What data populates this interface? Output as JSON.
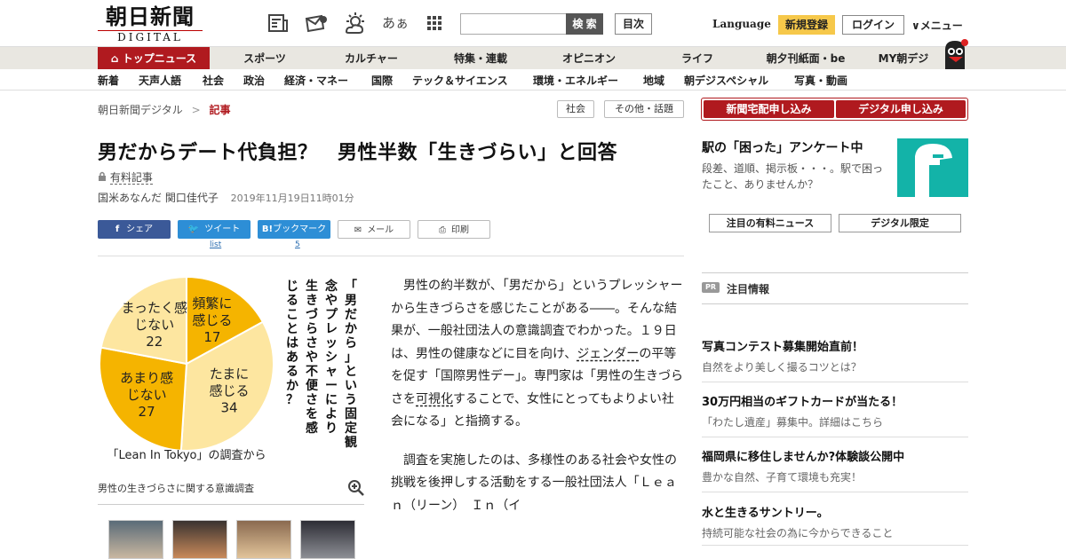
{
  "header": {
    "logo_main": "朝日新聞",
    "logo_sub": "DIGITAL",
    "icons": [
      "newspaper-icon",
      "mail-icon",
      "weather-icon",
      "font-size-icon",
      "grid-menu-icon"
    ],
    "font_icon_text": "あぁ",
    "search_placeholder": "",
    "search_button": "検 索",
    "toc_button": "目次",
    "language": "Language",
    "register": "新規登録",
    "login": "ログイン",
    "menu": "メニュー"
  },
  "nav_primary": [
    "トップニュース",
    "スポーツ",
    "カルチャー",
    "特集・連載",
    "オピニオン",
    "ライフ",
    "朝夕刊紙面・be",
    "MY朝デジ"
  ],
  "nav_secondary": [
    "新着",
    "天声人語",
    "社会",
    "政治",
    "経済・マネー",
    "国際",
    "テック＆サイエンス",
    "環境・エネルギー",
    "地域",
    "朝デジスペシャル",
    "写真・動画"
  ],
  "breadcrumb": {
    "home": "朝日新聞デジタル",
    "sep": ">",
    "current": "記事"
  },
  "tags": [
    "社会",
    "その他・話題"
  ],
  "article": {
    "title": "男だからデート代負担？　男性半数「生きづらい」と回答",
    "paid_label": "有料記事",
    "authors": "国米あなんだ 関口佳代子",
    "date": "2019年11月19日11時01分",
    "share": {
      "facebook": "シェア",
      "twitter": "ツイート",
      "twitter_count": "list",
      "hatena": "ブックマーク",
      "hatena_count": "5",
      "mail": "メール",
      "print": "印刷"
    },
    "figure_caption": "男性の生きづらさに関する意識調査",
    "paragraph1_a": "男性の約半数が、「男だから」というプレッシャーから生きづらさを感じたことがある――。そんな結果が、一般社団法人の意識調査でわかった。１９日は、男性の健康などに目を向け、",
    "paragraph1_link1": "ジェンダー",
    "paragraph1_b": "の平等を促す「国際男性デー」。専門家は「男性の生きづらさを",
    "paragraph1_link2": "可視化",
    "paragraph1_c": "することで、女性にとってもよりよい社会になる」と指摘する。",
    "paragraph2": "調査を実施したのは、多様性のある社会や女性の挑戦を後押しする活動をする一般社団法人「Ｌｅａｎ（リーン）　Ｉｎ（イ"
  },
  "chart_data": {
    "type": "pie",
    "title": "「男だから」という固定観念やプレッシャーにより生きづらさや不便さを感じることはあるか？",
    "source": "「Lean In Tokyo」の調査から",
    "unit": "%",
    "slices": [
      {
        "label": "頻繁に感じる",
        "value": 17,
        "color": "#f5b400"
      },
      {
        "label": "たまに感じる",
        "value": 34,
        "color": "#fde6a0"
      },
      {
        "label": "あまり感じない",
        "value": 27,
        "color": "#f5b400"
      },
      {
        "label": "まったく感じない",
        "value": 22,
        "color": "#fde6a0"
      }
    ]
  },
  "sidebar": {
    "subscribe_newspaper": "新聞宅配申し込み",
    "subscribe_digital": "デジタル申し込み",
    "ad_title": "駅の「困った」アンケート中",
    "ad_desc": "段差、道順、掲示板・・・。駅で困ったこと、ありませんか？",
    "btn_paid_news": "注目の有料ニュース",
    "btn_digital_only": "デジタル限定",
    "pr_badge": "PR",
    "pr_title": "注目情報",
    "pr_items": [
      {
        "title": "写真コンテスト募集開始直前！",
        "desc": "自然をより美しく撮るコツとは？"
      },
      {
        "title": "30万円相当のギフトカードが当たる！",
        "desc": "「わたし遺産」募集中。詳細はこちら"
      },
      {
        "title": "福岡県に移住しませんか?体験談公開中",
        "desc": "豊かな自然、子育て環境も充実！"
      },
      {
        "title": "水と生きるサントリー。",
        "desc": "持続可能な社会の為に今からできること"
      }
    ]
  }
}
